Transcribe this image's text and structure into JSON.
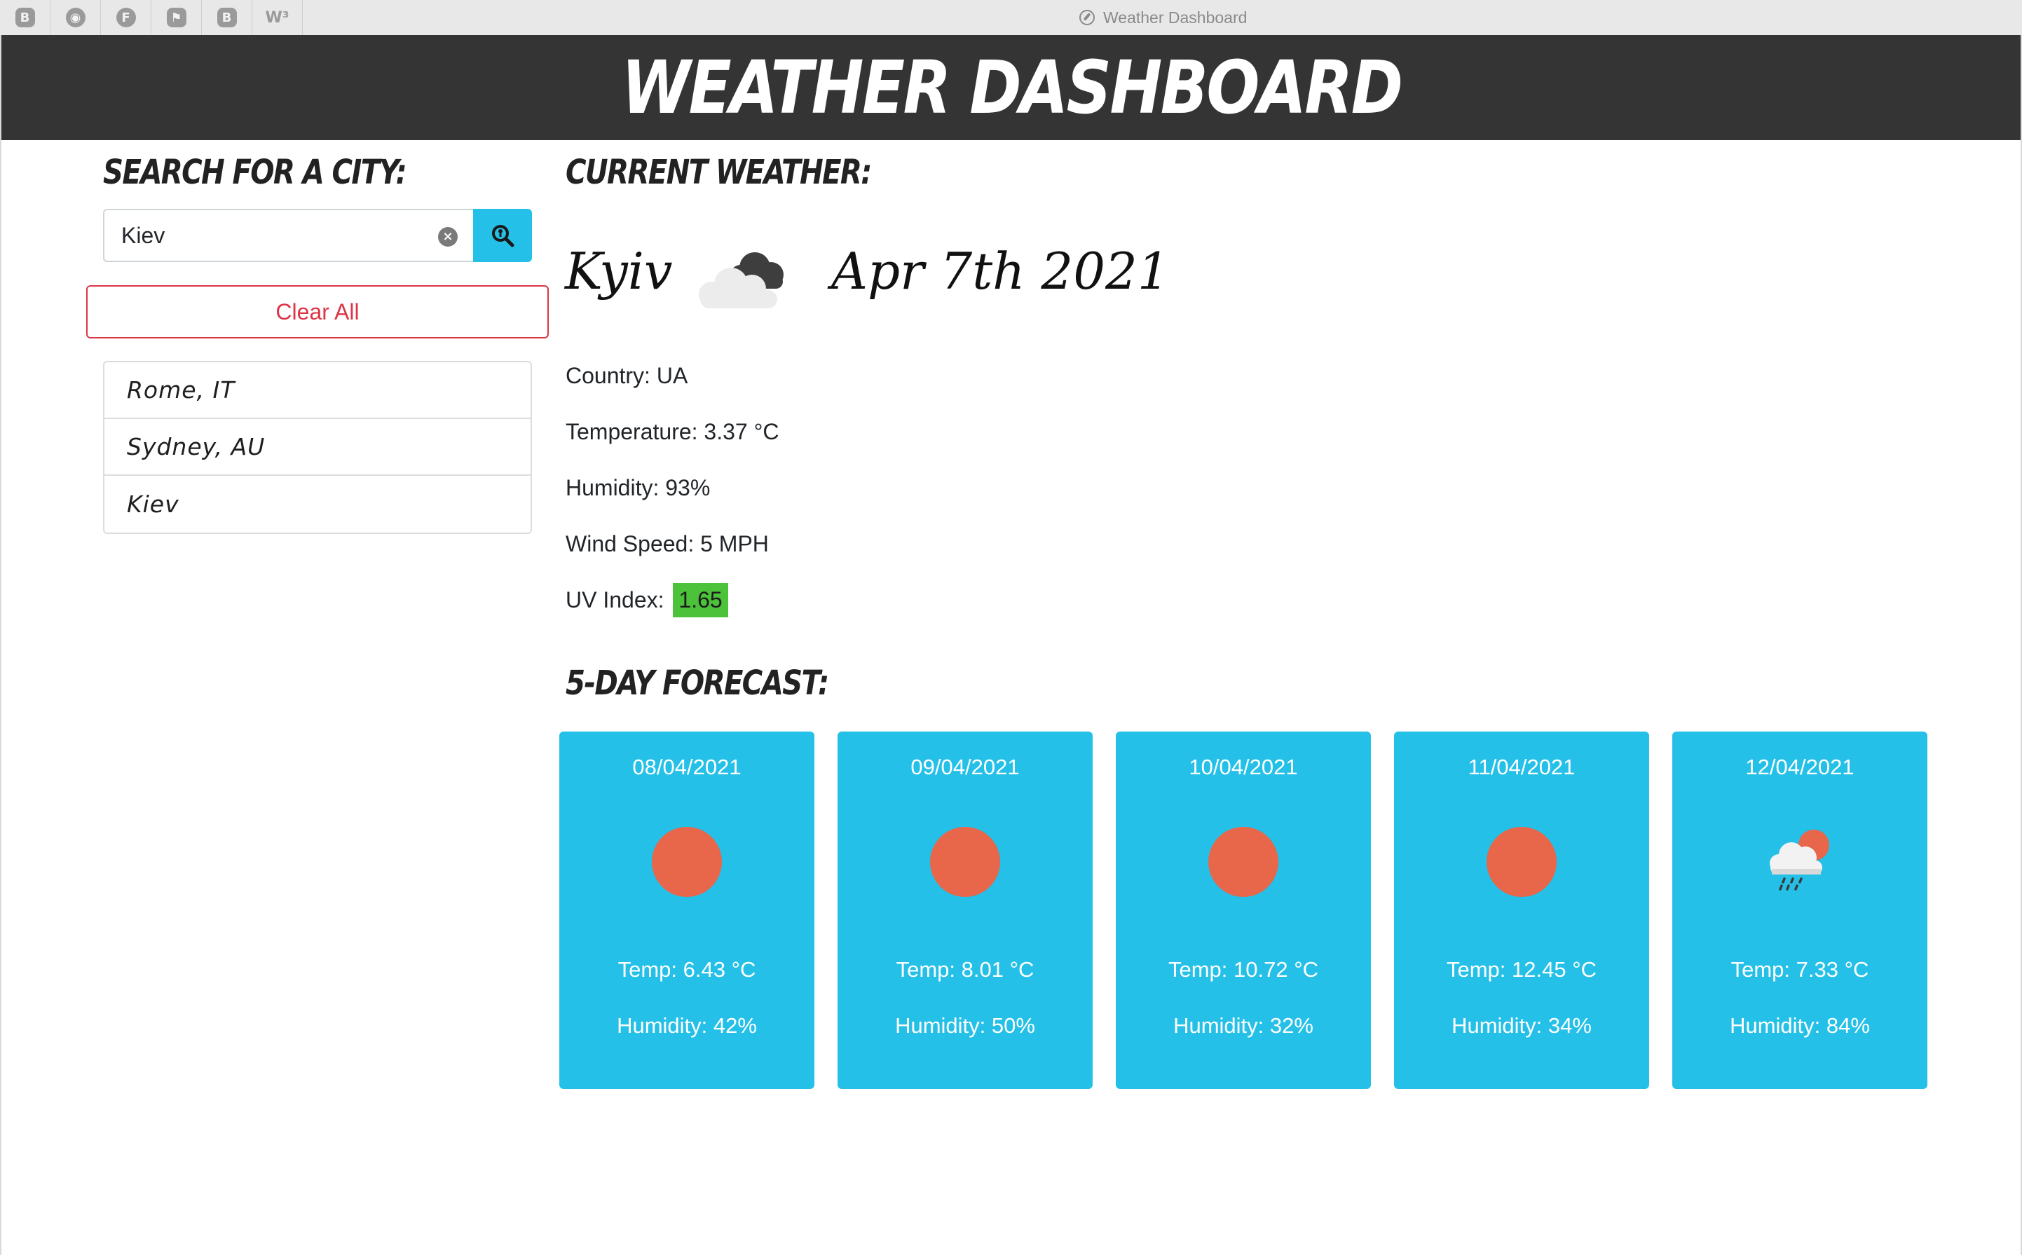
{
  "browser": {
    "tab_icons": [
      {
        "name": "bootstrap-icon",
        "glyph": "B"
      },
      {
        "name": "github-icon",
        "glyph": "◉"
      },
      {
        "name": "favicon-f-icon",
        "glyph": "F"
      },
      {
        "name": "flag-icon",
        "glyph": "⚑"
      },
      {
        "name": "bootstrap-alt-icon",
        "glyph": "B"
      },
      {
        "name": "w3schools-icon",
        "glyph": "W³"
      }
    ],
    "window_title": "Weather Dashboard"
  },
  "header": {
    "title": "Weather Dashboard"
  },
  "search": {
    "heading": "Search for a City:",
    "input_value": "Kiev",
    "clear_all_label": "Clear All",
    "history": [
      "Rome, IT",
      "Sydney, AU",
      "Kiev"
    ]
  },
  "current": {
    "heading": "Current Weather:",
    "city": "Kyiv",
    "icon": "cloud-icon",
    "date": "Apr 7th 2021",
    "country": "Country: UA",
    "temperature": "Temperature: 3.37 °C",
    "humidity": "Humidity: 93%",
    "wind": "Wind Speed: 5 MPH",
    "uv_label": "UV Index:",
    "uv_value": "1.65"
  },
  "forecast": {
    "heading": "5-Day Forecast:",
    "days": [
      {
        "date": "08/04/2021",
        "icon": "sun-icon",
        "temp": "Temp: 6.43 °C",
        "humidity": "Humidity: 42%"
      },
      {
        "date": "09/04/2021",
        "icon": "sun-icon",
        "temp": "Temp: 8.01 °C",
        "humidity": "Humidity: 50%"
      },
      {
        "date": "10/04/2021",
        "icon": "sun-icon",
        "temp": "Temp: 10.72 °C",
        "humidity": "Humidity: 32%"
      },
      {
        "date": "11/04/2021",
        "icon": "sun-icon",
        "temp": "Temp: 12.45 °C",
        "humidity": "Humidity: 34%"
      },
      {
        "date": "12/04/2021",
        "icon": "rain-sun-icon",
        "temp": "Temp: 7.33 °C",
        "humidity": "Humidity: 84%"
      }
    ]
  },
  "colors": {
    "header_bg": "#343434",
    "accent": "#25c0e8",
    "danger": "#dc3545",
    "uv_low": "#4cc13a",
    "sun": "#e8664a"
  }
}
